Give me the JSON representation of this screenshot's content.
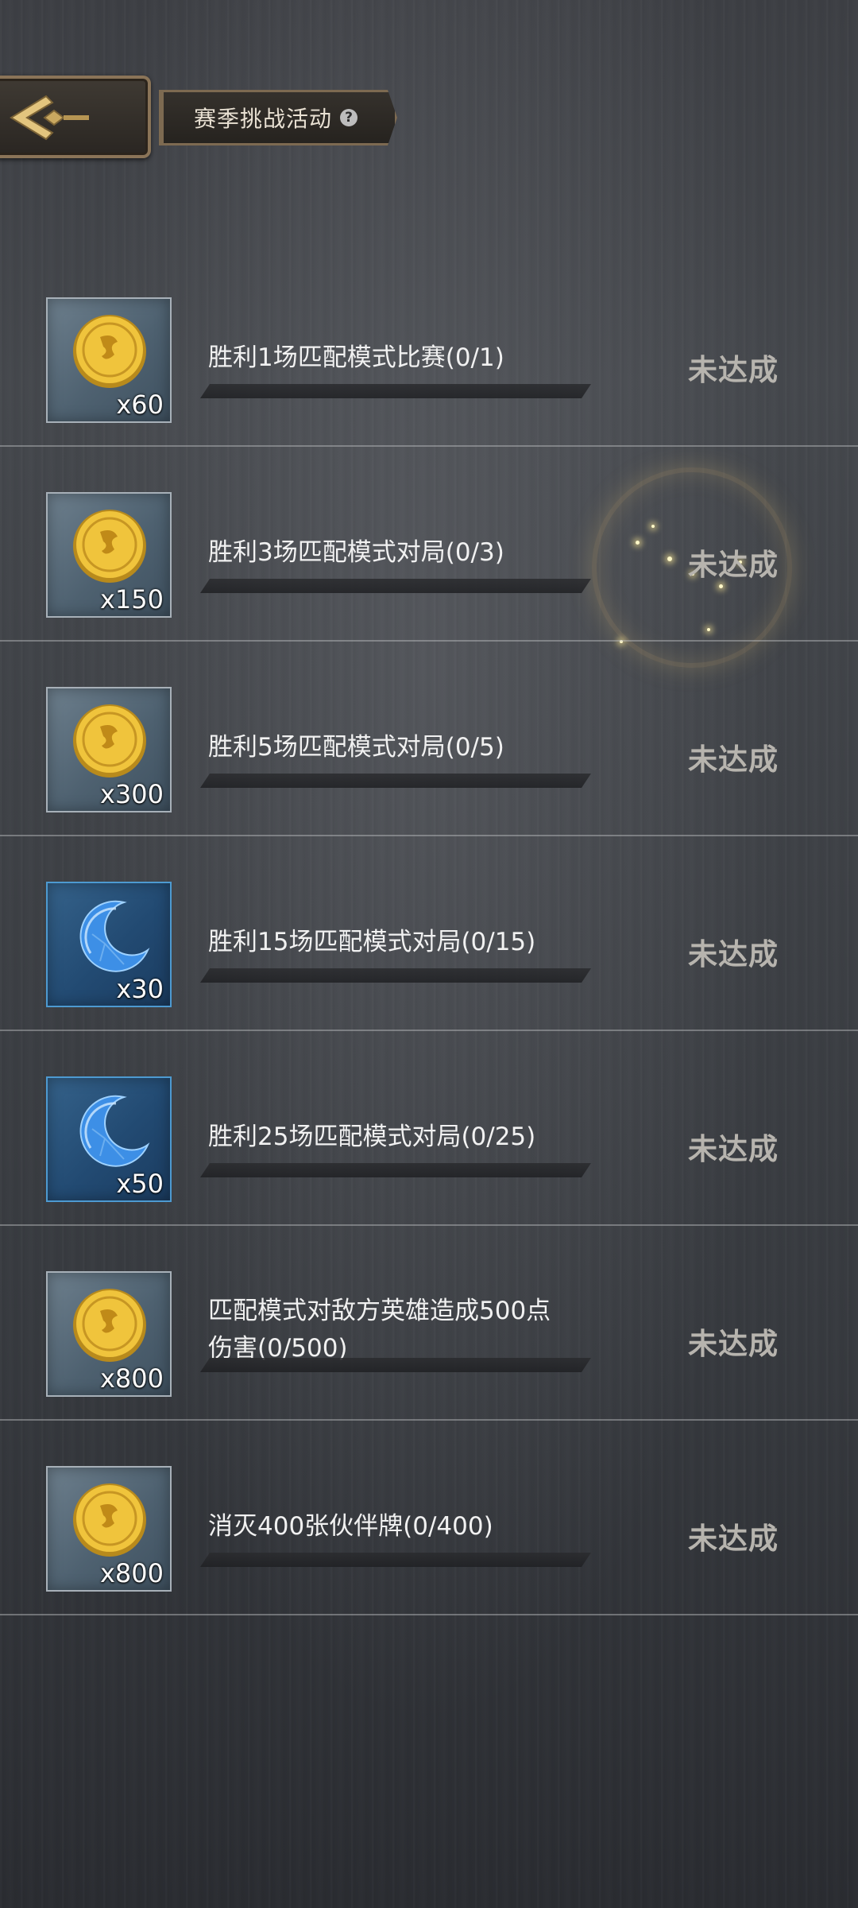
{
  "header": {
    "title": "赛季挑战活动",
    "help_icon": "question-circle-icon",
    "back_icon": "back-arrow-icon"
  },
  "tasks": [
    {
      "reward_icon": "gold-coin-icon",
      "quantity": "x60",
      "text": "胜利1场匹配模式比赛(0/1)",
      "status": "未达成"
    },
    {
      "reward_icon": "gold-coin-icon",
      "quantity": "x150",
      "text": "胜利3场匹配模式对局(0/3)",
      "status": "未达成"
    },
    {
      "reward_icon": "gold-coin-icon",
      "quantity": "x300",
      "text": "胜利5场匹配模式对局(0/5)",
      "status": "未达成"
    },
    {
      "reward_icon": "blue-moon-gem-icon",
      "quantity": "x30",
      "text": "胜利15场匹配模式对局(0/15)",
      "status": "未达成"
    },
    {
      "reward_icon": "blue-moon-gem-icon",
      "quantity": "x50",
      "text": "胜利25场匹配模式对局(0/25)",
      "status": "未达成"
    },
    {
      "reward_icon": "gold-coin-icon",
      "quantity": "x800",
      "text": "匹配模式对敌方英雄造成500点",
      "text2": "伤害(0/500)",
      "status": "未达成"
    },
    {
      "reward_icon": "gold-coin-icon",
      "quantity": "x800",
      "text": "消灭400张伙伴牌(0/400)",
      "status": "未达成"
    }
  ]
}
